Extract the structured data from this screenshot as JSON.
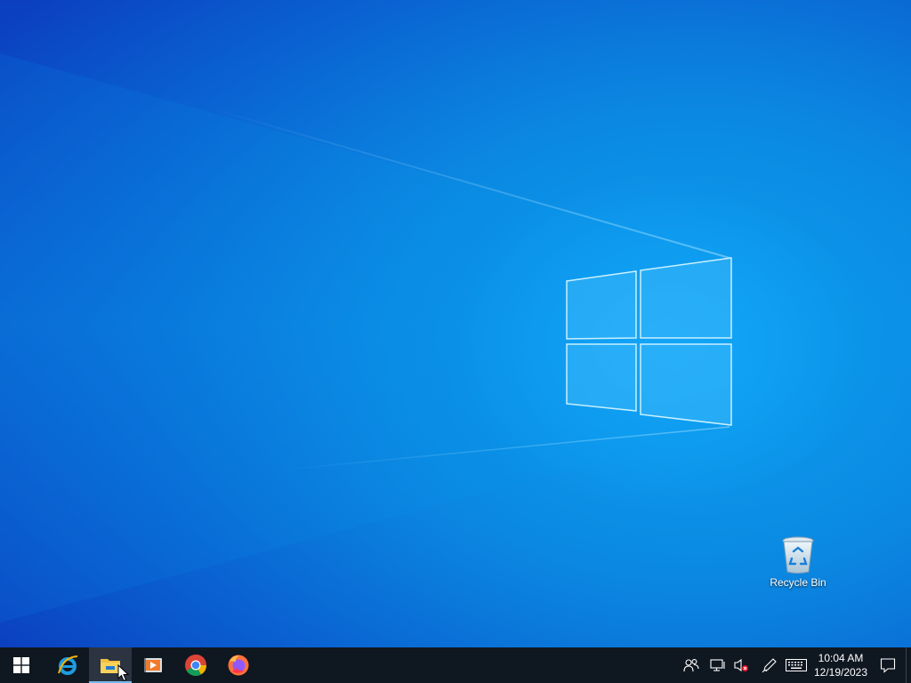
{
  "desktop": {
    "icons": [
      {
        "label": "Recycle Bin",
        "icon": "recycle-bin-icon"
      }
    ]
  },
  "taskbar": {
    "start": {
      "icon": "windows-start-icon"
    },
    "pinned": [
      {
        "icon": "internet-explorer-icon",
        "active": false
      },
      {
        "icon": "file-explorer-icon",
        "active": true
      },
      {
        "icon": "media-player-icon",
        "active": false
      },
      {
        "icon": "chrome-icon",
        "active": false
      },
      {
        "icon": "firefox-icon",
        "active": false
      }
    ],
    "tray": {
      "icons": [
        "people-icon",
        "network-icon",
        "volume-muted-icon",
        "pen-icon",
        "keyboard-icon"
      ],
      "time": "10:04 AM",
      "date": "12/19/2023",
      "notification_icon": "action-center-icon"
    }
  },
  "colors": {
    "taskbar": "#0f1720",
    "accent": "#76b9ed",
    "wallpaper": "#0a78d7"
  }
}
